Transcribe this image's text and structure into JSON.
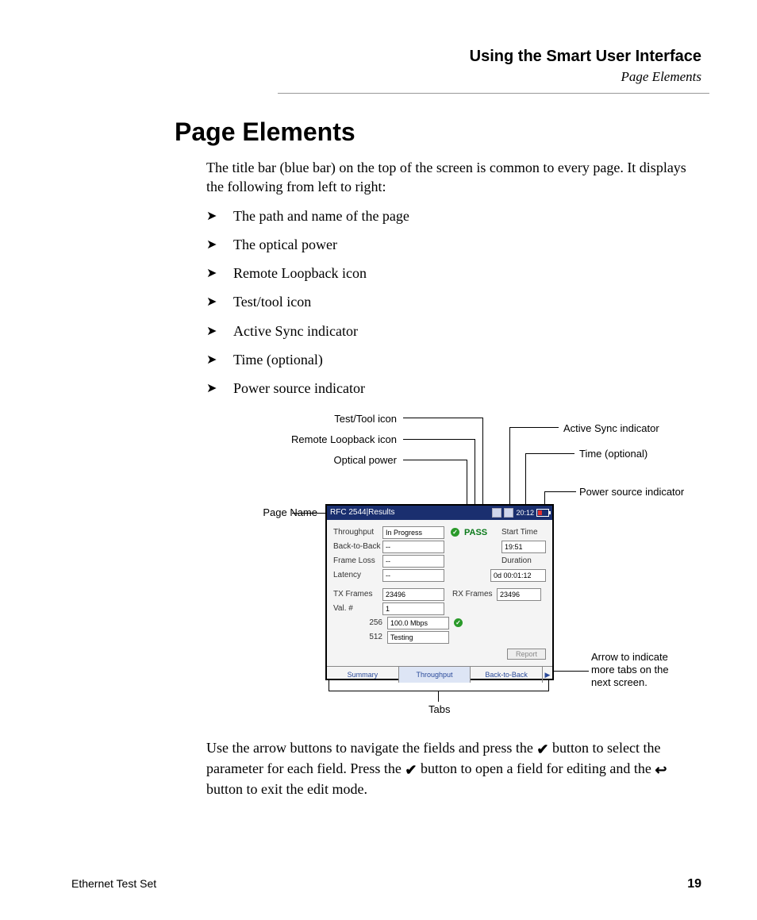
{
  "header": {
    "chapter": "Using the Smart User Interface",
    "section": "Page Elements"
  },
  "title": "Page Elements",
  "intro": "The title bar (blue bar) on the top of the screen is common to every page. It displays the following from left to right:",
  "bullets": [
    "The path and name of the page",
    "The optical power",
    "Remote Loopback icon",
    "Test/tool icon",
    "Active Sync indicator",
    "Time (optional)",
    "Power source indicator"
  ],
  "callouts": {
    "left": {
      "page_name": "Page Name",
      "optical_power": "Optical power",
      "remote_loopback": "Remote Loopback icon",
      "test_tool": "Test/Tool icon"
    },
    "right": {
      "active_sync": "Active Sync indicator",
      "time": "Time (optional)",
      "power_source": "Power source indicator",
      "arrow_note_l1": "Arrow to indicate",
      "arrow_note_l2": "more tabs on the",
      "arrow_note_l3": "next screen."
    },
    "bottom": "Tabs"
  },
  "device": {
    "title": "RFC 2544|Results",
    "time": "20:12",
    "pass_label": "PASS",
    "rows": {
      "throughput_label": "Throughput",
      "throughput_value": "In Progress",
      "back_to_back_label": "Back-to-Back",
      "back_to_back_value": "--",
      "frame_loss_label": "Frame Loss",
      "frame_loss_value": "--",
      "latency_label": "Latency",
      "latency_value": "--",
      "start_time_label": "Start Time",
      "start_time_value": "19:51",
      "duration_label": "Duration",
      "duration_value": "0d 00:01:12",
      "tx_frames_label": "TX Frames",
      "tx_frames_value": "23496",
      "rx_frames_label": "RX Frames",
      "rx_frames_value": "23496",
      "val_label": "Val. #",
      "val_value": "1",
      "size256_label": "256",
      "size256_value": "100.0 Mbps",
      "size512_label": "512",
      "size512_value": "Testing",
      "report_btn": "Report"
    },
    "tabs": {
      "summary": "Summary",
      "throughput": "Throughput",
      "back_to_back": "Back-to-Back"
    }
  },
  "after": {
    "p1a": "Use the arrow buttons to navigate the fields and press the ",
    "p1b": " button to select the parameter for each field. Press the ",
    "p1c": " button to open a field for editing and the ",
    "p1d": " button to exit the edit mode."
  },
  "footer": {
    "product": "Ethernet Test Set",
    "page_number": "19"
  }
}
